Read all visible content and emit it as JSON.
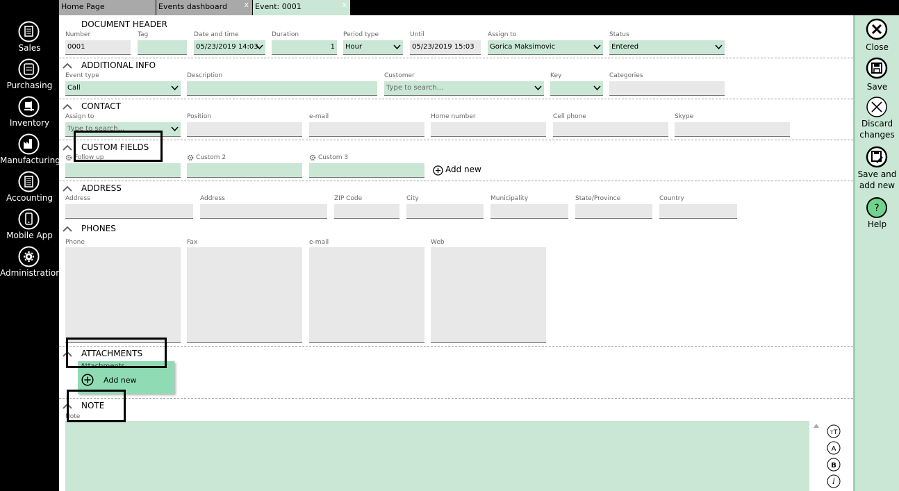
{
  "nav": {
    "items": [
      {
        "label": "Sales",
        "icon": "sales-icon"
      },
      {
        "label": "Purchasing",
        "icon": "purchasing-icon"
      },
      {
        "label": "Inventory",
        "icon": "inventory-icon"
      },
      {
        "label": "Manufacturing",
        "icon": "manufacturing-icon"
      },
      {
        "label": "Accounting",
        "icon": "accounting-icon"
      },
      {
        "label": "Mobile App",
        "icon": "mobile-app-icon"
      },
      {
        "label": "Administration",
        "icon": "administration-icon"
      }
    ]
  },
  "tabs": [
    {
      "label": "Home Page",
      "close": ""
    },
    {
      "label": "Events dashboard",
      "close": "x"
    },
    {
      "label": "Event: 0001",
      "close": "x"
    }
  ],
  "header": {
    "title": "DOCUMENT HEADER",
    "number_label": "Number",
    "number_value": "0001",
    "tag_label": "Tag",
    "tag_value": "",
    "datetime_label": "Date and time",
    "datetime_value": "05/23/2019 14:03",
    "duration_label": "Duration",
    "duration_value": "1",
    "period_label": "Period type",
    "period_value": "Hour",
    "until_label": "Until",
    "until_value": "05/23/2019 15:03",
    "assign_label": "Assign to",
    "assign_value": "Gorica Maksimovic",
    "status_label": "Status",
    "status_value": "Entered"
  },
  "additional": {
    "title": "ADDITIONAL INFO",
    "event_type_label": "Event type",
    "event_type_value": "Call",
    "description_label": "Description",
    "customer_label": "Customer",
    "customer_placeholder": "Type to search...",
    "key_label": "Key",
    "categories_label": "Categories"
  },
  "contact": {
    "title": "CONTACT",
    "assign_label": "Assign to",
    "assign_placeholder": "Type to search...",
    "position_label": "Position",
    "email_label": "e-mail",
    "home_label": "Home number",
    "cell_label": "Cell phone",
    "skype_label": "Skype"
  },
  "custom": {
    "title": "CUSTOM FIELDS",
    "c1_label": "Follow up",
    "c2_label": "Custom 2",
    "c3_label": "Custom 3",
    "add_new": "Add new"
  },
  "address": {
    "title": "ADDRESS",
    "a1_label": "Address",
    "a2_label": "Address",
    "zip_label": "ZIP Code",
    "city_label": "City",
    "municipality_label": "Municipality",
    "state_label": "State/Province",
    "country_label": "Country"
  },
  "phones": {
    "title": "PHONES",
    "phone_label": "Phone",
    "fax_label": "Fax",
    "email_label": "e-mail",
    "web_label": "Web"
  },
  "attachments": {
    "title": "ATTACHMENTS",
    "label": "Attachments",
    "add_new": "Add new"
  },
  "note": {
    "title": "NOTE",
    "label": "Note"
  },
  "toolbar": {
    "close": "Close",
    "save": "Save",
    "discard_1": "Discard",
    "discard_2": "changes",
    "save_add_1": "Save and",
    "save_add_2": "add new",
    "help": "Help"
  },
  "colors": {
    "accent_green": "#c9e7d4",
    "attachment_green": "#8fdcb4",
    "help_green": "#6fd38c",
    "field_grey": "#e8e8e8"
  }
}
